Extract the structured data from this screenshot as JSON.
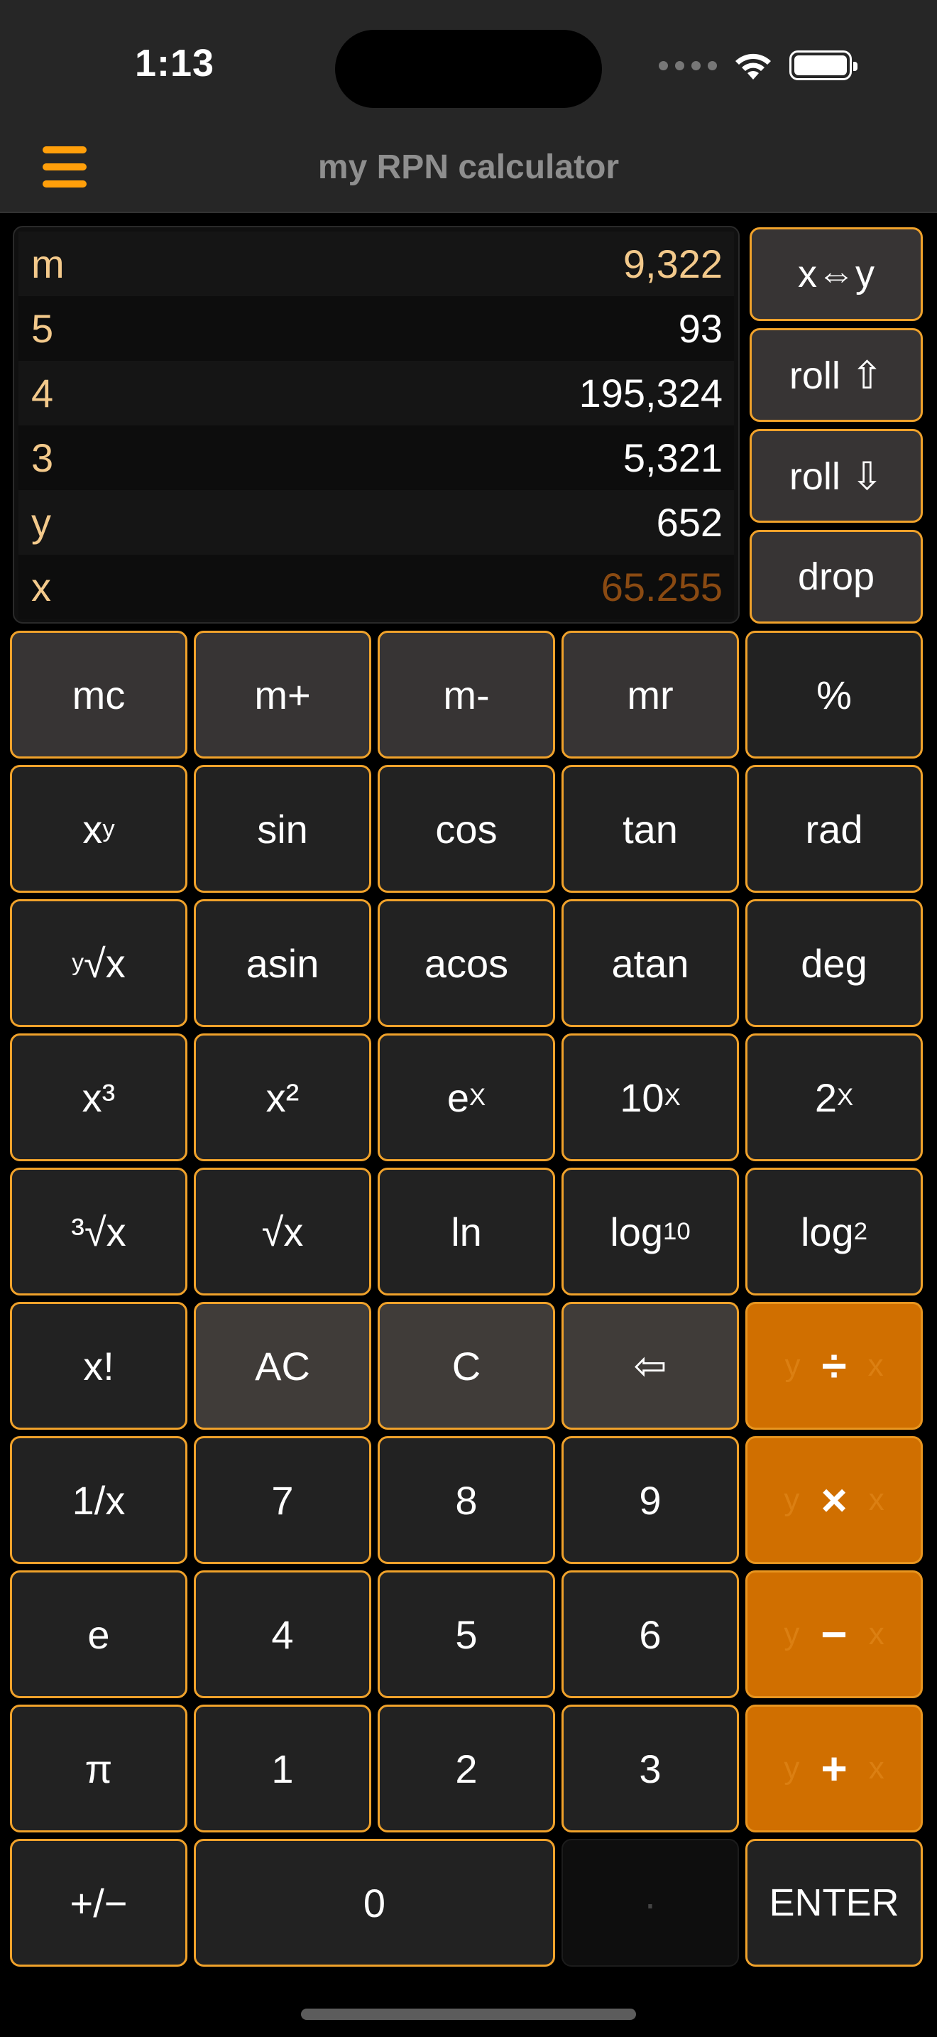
{
  "status_bar": {
    "time": "1:13"
  },
  "nav": {
    "title": "my RPN calculator",
    "menu_icon": "hamburger-menu-icon",
    "accent_color": "#ff9f0a"
  },
  "stack": [
    {
      "label": "m",
      "value": "9,322"
    },
    {
      "label": "5",
      "value": "93"
    },
    {
      "label": "4",
      "value": "195,324"
    },
    {
      "label": "3",
      "value": "5,321"
    },
    {
      "label": "y",
      "value": "652"
    },
    {
      "label": "x",
      "value": "65.255"
    }
  ],
  "stack_ops": {
    "swap": "x⇔y",
    "roll_up": "roll ⇧",
    "roll_down": "roll ⇩",
    "drop": "drop"
  },
  "keys": {
    "mc": "mc",
    "m_plus": "m+",
    "m_minus": "m-",
    "mr": "mr",
    "percent": "%",
    "x_pow_y_base": "x",
    "x_pow_y_exp": "y",
    "sin": "sin",
    "cos": "cos",
    "tan": "tan",
    "rad": "rad",
    "yroot_index": "y",
    "yroot_body": "√x",
    "asin": "asin",
    "acos": "acos",
    "atan": "atan",
    "deg": "deg",
    "cube": "x³",
    "square": "x²",
    "exp_base": "e",
    "exp_pow": "X",
    "ten_base": "10",
    "ten_pow": "X",
    "two_base": "2",
    "two_pow": "X",
    "cbrt": "³√x",
    "sqrt": "√x",
    "ln": "ln",
    "log10_base": "log",
    "log10_sub": "10",
    "log2_base": "log",
    "log2_sub": "2",
    "factorial": "x!",
    "ac": "AC",
    "c": "C",
    "backspace": "⇦",
    "divide_y": "y",
    "divide": "÷",
    "divide_x": "x",
    "reciprocal": "1/x",
    "d7": "7",
    "d8": "8",
    "d9": "9",
    "multiply_y": "y",
    "multiply": "×",
    "multiply_x": "x",
    "e_const": "e",
    "d4": "4",
    "d5": "5",
    "d6": "6",
    "subtract_y": "y",
    "subtract": "−",
    "subtract_x": "x",
    "pi": "π",
    "d1": "1",
    "d2": "2",
    "d3": "3",
    "add_y": "y",
    "add": "+",
    "add_x": "x",
    "negate": "+/−",
    "d0": "0",
    "decimal": "·",
    "enter": "ENTER"
  },
  "colors": {
    "operator_bg": "#d06f00",
    "key_border": "#f0a22b",
    "stack_label": "#f3c98b",
    "x_value": "#8a4a12"
  }
}
